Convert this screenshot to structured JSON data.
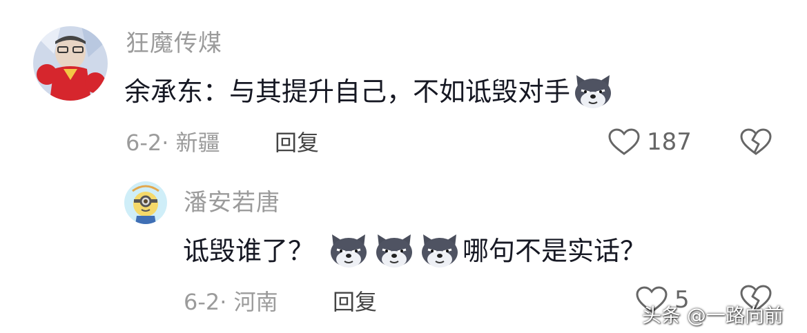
{
  "comments": [
    {
      "username": "狂魔传煤",
      "text_before": "余承东：与其提升自己，不如诋毁对手",
      "emoji": "doge-wolf-emoji",
      "date_location": "6-2· 新疆",
      "reply_label": "回复",
      "like_count": "187"
    },
    {
      "username": "潘安若唐",
      "text_before": "诋毁谁了？",
      "emoji_count": 3,
      "text_after": "哪句不是实话？",
      "date_location": "6-2· 河南",
      "reply_label": "回复",
      "like_count": "5"
    }
  ],
  "watermark": "头条 @一路向前",
  "colors": {
    "text": "#161823",
    "muted": "#9b9b9b",
    "background": "#ffffff"
  },
  "icons": [
    "heart-outline-icon",
    "broken-heart-icon",
    "doge-wolf-emoji"
  ]
}
